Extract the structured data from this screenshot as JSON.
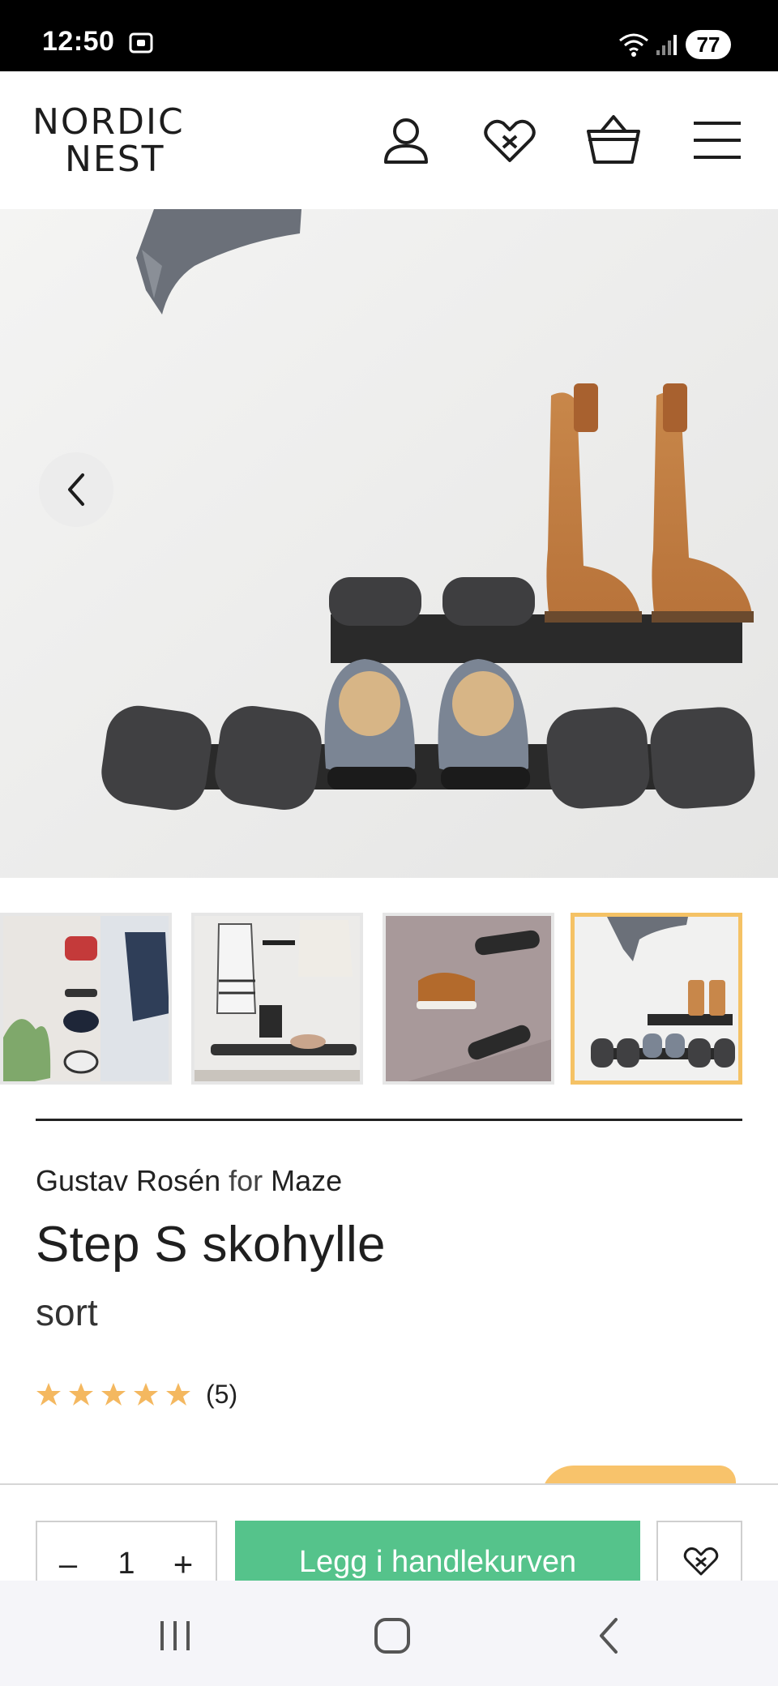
{
  "status_bar": {
    "time": "12:50",
    "battery": "77",
    "icons": [
      "screen-record-icon",
      "wifi-icon",
      "signal-icon"
    ]
  },
  "header": {
    "logo_line1": "NORDIC",
    "logo_line2": "NEST",
    "icons": [
      "account-icon",
      "wishlist-heart-icon",
      "basket-icon",
      "menu-icon"
    ]
  },
  "gallery": {
    "thumbnail_count": 4,
    "active_thumbnail": 4
  },
  "product": {
    "designer": "Gustav Rosén",
    "for_label": "for",
    "brand": "Maze",
    "title": "Step S skohylle",
    "variant": "sort",
    "rating_stars": 5,
    "review_count": "(5)"
  },
  "action_bar": {
    "qty_minus": "–",
    "qty_value": "1",
    "qty_plus": "+",
    "add_to_cart": "Legg i handlekurven"
  },
  "colors": {
    "accent_green": "#55c38b",
    "star": "#f4b860",
    "active_thumb_border": "#f5c265"
  },
  "nav_bar": {
    "icons": [
      "recent-apps-icon",
      "home-icon",
      "back-icon"
    ]
  }
}
